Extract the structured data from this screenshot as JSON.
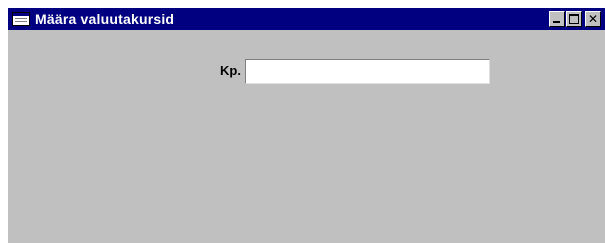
{
  "window": {
    "title": "Määra valuutakursid",
    "controls": {
      "minimize": "minimize-icon",
      "maximize": "maximize-icon",
      "close": "close-icon",
      "close_glyph": "✕"
    }
  },
  "form": {
    "kp_label": "Kp.",
    "kp_value": "",
    "kp_placeholder": ""
  },
  "colors": {
    "title_bar": "#000080",
    "window_bg": "#c0c0c0",
    "input_bg": "#ffffff"
  }
}
